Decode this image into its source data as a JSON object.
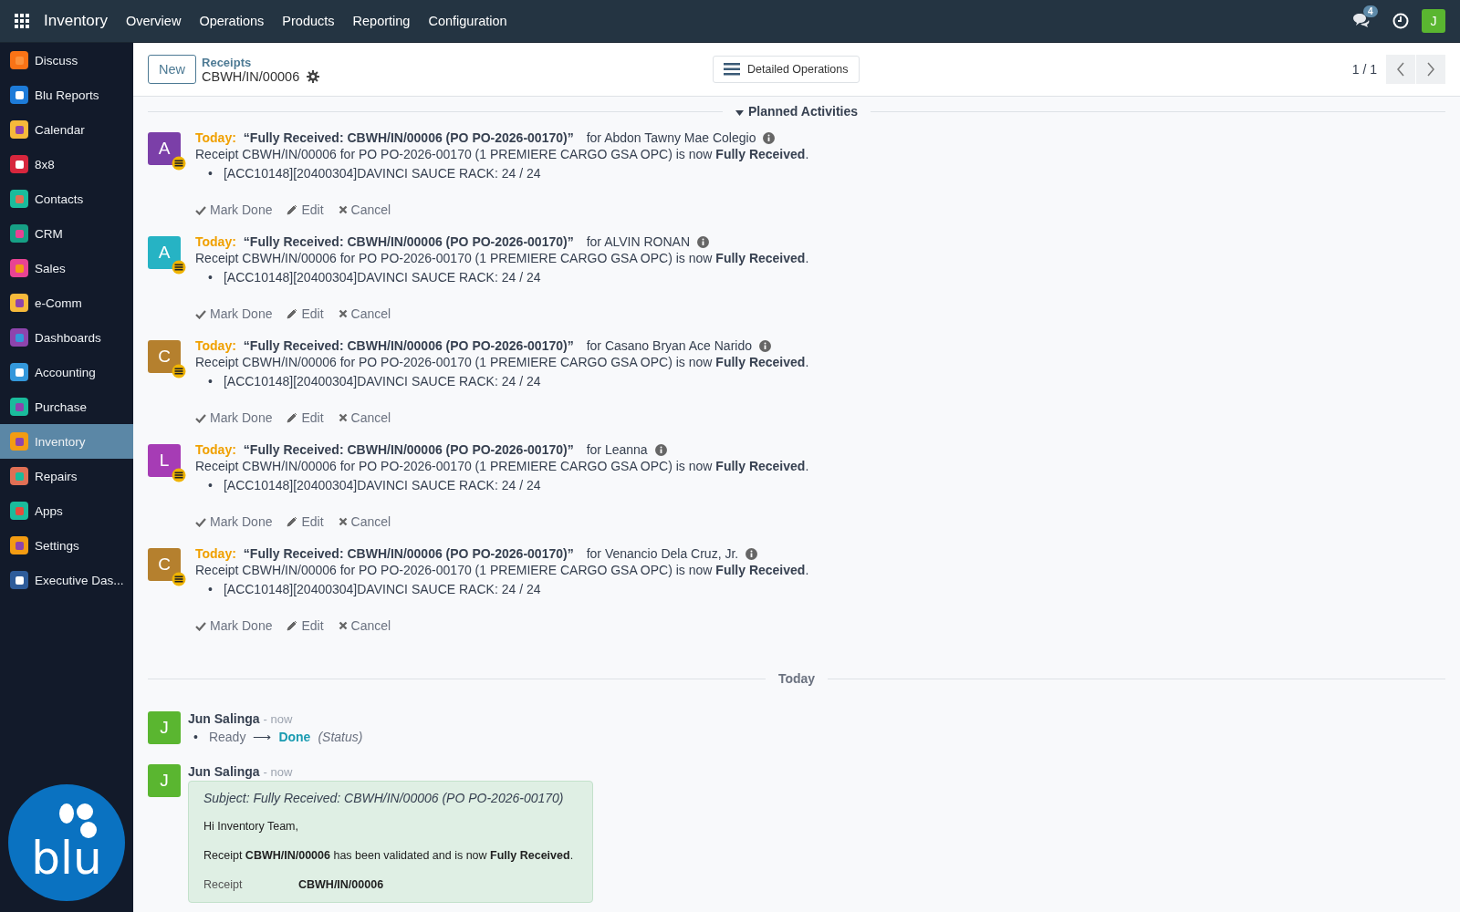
{
  "topbar": {
    "app_name": "Inventory",
    "menu": [
      "Overview",
      "Operations",
      "Products",
      "Reporting",
      "Configuration"
    ],
    "chat_badge": "4",
    "user_initial": "J"
  },
  "sidebar": {
    "items": [
      {
        "label": "Discuss",
        "selected": false
      },
      {
        "label": "Blu Reports",
        "selected": false
      },
      {
        "label": "Calendar",
        "selected": false
      },
      {
        "label": "8x8",
        "selected": false
      },
      {
        "label": "Contacts",
        "selected": false
      },
      {
        "label": "CRM",
        "selected": false
      },
      {
        "label": "Sales",
        "selected": false
      },
      {
        "label": "e-Comm",
        "selected": false
      },
      {
        "label": "Dashboards",
        "selected": false
      },
      {
        "label": "Accounting",
        "selected": false
      },
      {
        "label": "Purchase",
        "selected": false
      },
      {
        "label": "Inventory",
        "selected": true
      },
      {
        "label": "Repairs",
        "selected": false
      },
      {
        "label": "Apps",
        "selected": false
      },
      {
        "label": "Settings",
        "selected": false
      },
      {
        "label": "Executive Das...",
        "selected": false
      }
    ],
    "logo_text": "blu"
  },
  "control_panel": {
    "new_button": "New",
    "breadcrumb": "Receipts",
    "record": "CBWH/IN/00006",
    "view_button": "Detailed Operations",
    "pager": "1 / 1"
  },
  "planned_activities": {
    "title": "Planned Activities",
    "expanded": true,
    "items": [
      {
        "initial": "A",
        "color": "#7b3fa8",
        "due": "Today:",
        "summary": "“Fully Received: CBWH/IN/00006 (PO PO-2026-00170)”",
        "for_text": "for Abdon Tawny Mae Colegio",
        "note": "Receipt CBWH/IN/00006 for PO PO-2026-00170 (1 PREMIERE CARGO GSA OPC) is now **Fully Received**.",
        "bullet_mark": "•",
        "bullet": "[ACC10148][20400304]DAVINCI SAUCE RACK: 24 / 24",
        "actions": [
          "Mark Done",
          "Edit",
          "Cancel"
        ]
      },
      {
        "initial": "A",
        "color": "#26b3c4",
        "due": "Today:",
        "summary": "“Fully Received: CBWH/IN/00006 (PO PO-2026-00170)”",
        "for_text": "for ALVIN RONAN",
        "note": "Receipt CBWH/IN/00006 for PO PO-2026-00170 (1 PREMIERE CARGO GSA OPC) is now **Fully Received**.",
        "bullet_mark": "•",
        "bullet": "[ACC10148][20400304]DAVINCI SAUCE RACK: 24 / 24",
        "actions": [
          "Mark Done",
          "Edit",
          "Cancel"
        ]
      },
      {
        "initial": "C",
        "color": "#b5802e",
        "due": "Today:",
        "summary": "“Fully Received: CBWH/IN/00006 (PO PO-2026-00170)”",
        "for_text": "for Casano Bryan Ace Narido",
        "note": "Receipt CBWH/IN/00006 for PO PO-2026-00170 (1 PREMIERE CARGO GSA OPC) is now **Fully Received**.",
        "bullet_mark": "•",
        "bullet": "[ACC10148][20400304]DAVINCI SAUCE RACK: 24 / 24",
        "actions": [
          "Mark Done",
          "Edit",
          "Cancel"
        ]
      },
      {
        "initial": "L",
        "color": "#a63cb5",
        "due": "Today:",
        "summary": "“Fully Received: CBWH/IN/00006 (PO PO-2026-00170)”",
        "for_text": "for Leanna",
        "note": "Receipt CBWH/IN/00006 for PO PO-2026-00170 (1 PREMIERE CARGO GSA OPC) is now **Fully Received**.",
        "bullet_mark": "•",
        "bullet": "[ACC10148][20400304]DAVINCI SAUCE RACK: 24 / 24",
        "actions": [
          "Mark Done",
          "Edit",
          "Cancel"
        ]
      },
      {
        "initial": "C",
        "color": "#b5802e",
        "due": "Today:",
        "summary": "“Fully Received: CBWH/IN/00006 (PO PO-2026-00170)”",
        "for_text": "for Venancio Dela Cruz, Jr.",
        "note": "Receipt CBWH/IN/00006 for PO PO-2026-00170 (1 PREMIERE CARGO GSA OPC) is now **Fully Received**.",
        "bullet_mark": "•",
        "bullet": "[ACC10148][20400304]DAVINCI SAUCE RACK: 24 / 24",
        "actions": [
          "Mark Done",
          "Edit",
          "Cancel"
        ]
      }
    ]
  },
  "day_separator": "Today",
  "messages": [
    {
      "kind": "tracking",
      "bullet_mark": "•",
      "initial": "J",
      "author": "Jun Salinga",
      "time": "- now",
      "old_value": "Ready",
      "arrow": "⟶",
      "new_value": "Done",
      "field": "(Status)"
    },
    {
      "kind": "email",
      "initial": "J",
      "author": "Jun Salinga",
      "time": "- now",
      "subject": "Subject: Fully Received: CBWH/IN/00006 (PO PO-2026-00170)",
      "greeting": "Hi Inventory Team,",
      "body": "Receipt **CBWH/IN/00006** has been validated and is now **Fully Received**.",
      "table": [
        {
          "label": "Receipt",
          "value": "CBWH/IN/00006"
        }
      ]
    }
  ]
}
